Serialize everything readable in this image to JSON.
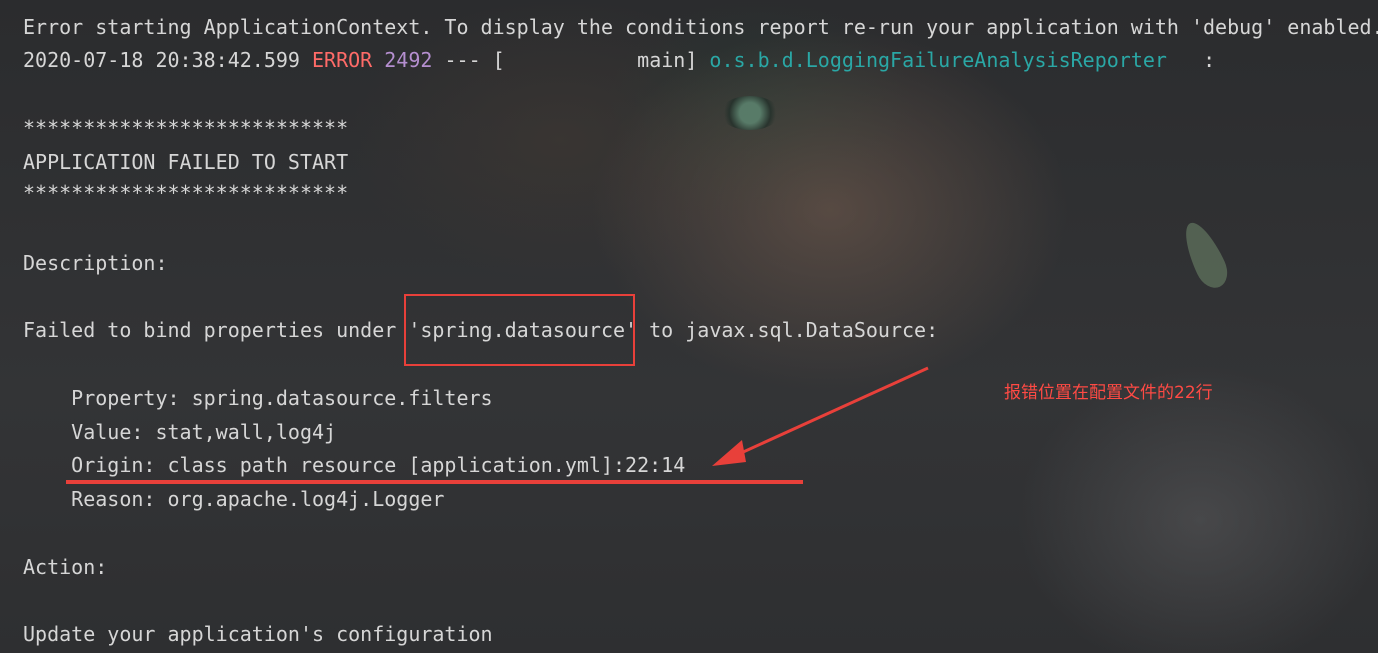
{
  "console": {
    "line1": "Error starting ApplicationContext. To display the conditions report re-run your application with 'debug' enabled.",
    "log": {
      "timestamp": "2020-07-18 20:38:42.599",
      "level": "ERROR",
      "pid": "2492",
      "separator": "--- [",
      "thread": "           main]",
      "logger": "o.s.b.d.LoggingFailureAnalysisReporter",
      "tail": "   :"
    },
    "stars_top": "***************************",
    "failed_title": "APPLICATION FAILED TO START",
    "stars_bottom": "***************************",
    "description_label": "Description:",
    "failed_prefix": "Failed to bind properties under ",
    "failed_key": "'spring.datasource'",
    "failed_suffix": " to javax.sql.DataSource:",
    "property": "    Property: spring.datasource.filters",
    "value": "    Value: stat,wall,log4j",
    "origin": "    Origin: class path resource [application.yml]:22:14",
    "reason": "    Reason: org.apache.log4j.Logger",
    "action_label": "Action:",
    "action_text": "Update your application's configuration"
  },
  "annotation": {
    "text": "报错位置在配置文件的22行",
    "color": "#e8403a"
  },
  "colors": {
    "error_level": "#ff6b68",
    "pid": "#b58fd0",
    "logger": "#2aa7a5",
    "text": "#d6d6d6",
    "background": "#2d2e30"
  }
}
